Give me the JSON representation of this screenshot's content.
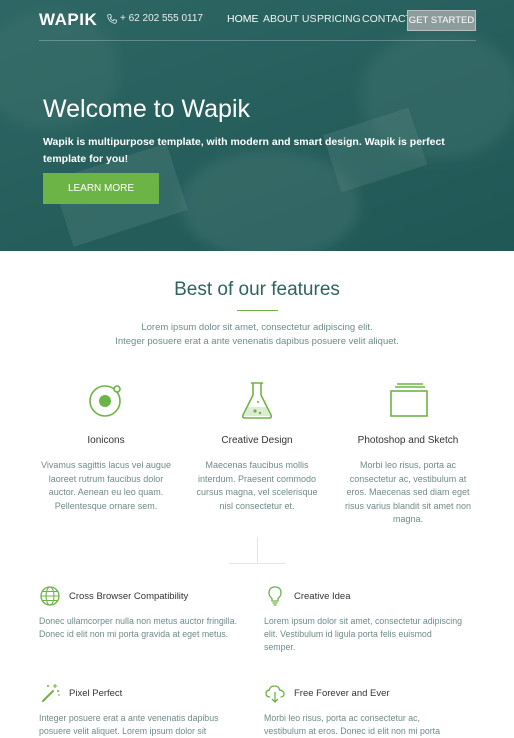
{
  "nav": {
    "logo": "WAPIK",
    "phone": "+ 62 202 555 0117",
    "links": [
      "HOME",
      "ABOUT US",
      "PRICING",
      "CONTACT"
    ],
    "cta": "GET STARTED"
  },
  "hero": {
    "title": "Welcome to Wapik",
    "text": "Wapik is multipurpose template, with modern and smart design. Wapik is perfect template for you!",
    "button": "LEARN MORE"
  },
  "features": {
    "title": "Best of our features",
    "subtitle_line1": "Lorem ipsum dolor sit amet, consectetur adipiscing elit.",
    "subtitle_line2": "Integer posuere erat a ante venenatis dapibus posuere velit aliquet.",
    "columns": [
      {
        "icon": "ionicons-icon",
        "title": "Ionicons",
        "text": "Vivamus sagittis lacus vel augue laoreet rutrum faucibus dolor auctor. Aenean eu leo quam. Pellentesque ornare sem."
      },
      {
        "icon": "flask-icon",
        "title": "Creative Design",
        "text": "Maecenas faucibus mollis interdum. Praesent commodo cursus magna, vel scelerisque nisl consectetur et."
      },
      {
        "icon": "layers-icon",
        "title": "Photoshop and Sketch",
        "text": "Morbi leo risus, porta ac consectetur ac, vestibulum at eros. Maecenas sed diam eget risus varius blandit sit amet non magna."
      }
    ],
    "rows": [
      {
        "icon": "globe-icon",
        "title": "Cross Browser Compatibility",
        "text": "Donec ullamcorper nulla non metus auctor fringilla. Donec id elit non mi porta gravida at eget metus."
      },
      {
        "icon": "lightbulb-icon",
        "title": "Creative Idea",
        "text": "Lorem ipsum dolor sit amet, consectetur adipiscing elit. Vestibulum id ligula porta felis euismod semper."
      },
      {
        "icon": "magic-wand-icon",
        "title": "Pixel Perfect",
        "text": "Integer posuere erat a ante venenatis dapibus posuere velit aliquet. Lorem ipsum dolor sit"
      },
      {
        "icon": "cloud-download-icon",
        "title": "Free Forever and Ever",
        "text": "Morbi leo risus, porta ac consectetur ac, vestibulum at eros. Donec id elit non mi porta"
      }
    ]
  },
  "colors": {
    "accent": "#6db446",
    "hero_overlay": "#2e6764",
    "heading": "#2f6360",
    "body_text": "#6f8a89"
  }
}
